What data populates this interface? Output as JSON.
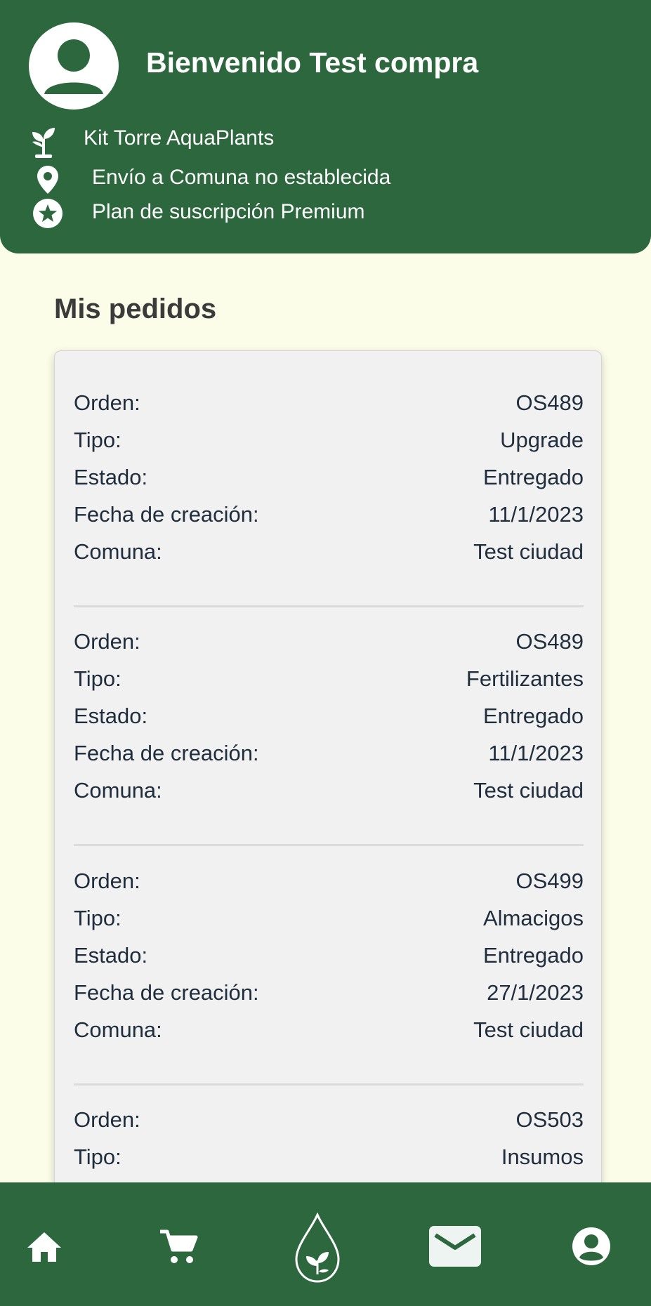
{
  "header": {
    "welcome": "Bienvenido Test compra",
    "info": [
      {
        "icon": "sprout-icon",
        "text": "Kit Torre AquaPlants"
      },
      {
        "icon": "location-pin-icon",
        "text": "Envío a Comuna no establecida"
      },
      {
        "icon": "star-icon",
        "text": "Plan de suscripción Premium"
      }
    ]
  },
  "orders_title": "Mis pedidos",
  "labels": {
    "orden": "Orden:",
    "tipo": "Tipo:",
    "estado": "Estado:",
    "fecha": "Fecha de creación:",
    "comuna": "Comuna:"
  },
  "orders": [
    {
      "orden": "OS489",
      "tipo": "Upgrade",
      "estado": "Entregado",
      "fecha": "11/1/2023",
      "comuna": "Test ciudad"
    },
    {
      "orden": "OS489",
      "tipo": "Fertilizantes",
      "estado": "Entregado",
      "fecha": "11/1/2023",
      "comuna": "Test ciudad"
    },
    {
      "orden": "OS499",
      "tipo": "Almacigos",
      "estado": "Entregado",
      "fecha": "27/1/2023",
      "comuna": "Test ciudad"
    },
    {
      "orden": "OS503",
      "tipo": "Insumos"
    }
  ],
  "nav": [
    {
      "icon": "home-icon"
    },
    {
      "icon": "cart-icon"
    },
    {
      "icon": "plant-drop-icon"
    },
    {
      "icon": "mail-icon"
    },
    {
      "icon": "account-icon"
    }
  ],
  "colors": {
    "primary_green": "#2c673d",
    "page_background": "#fbfde9",
    "card_background": "#f1f1f1"
  }
}
